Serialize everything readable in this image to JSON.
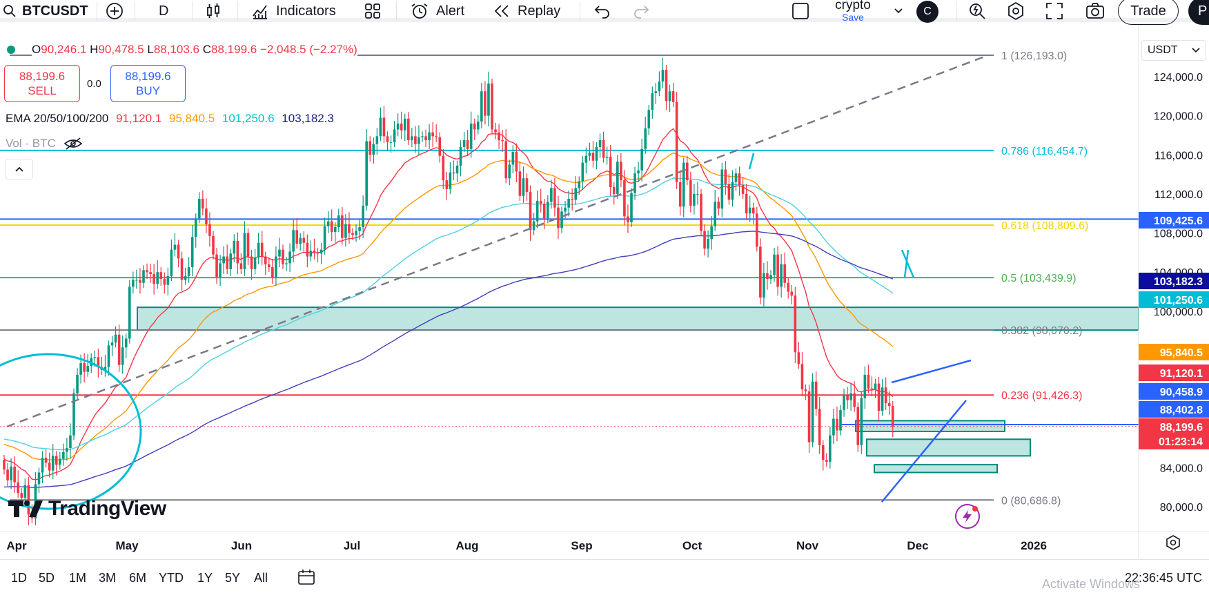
{
  "toolbar": {
    "symbol": "BTCUSDT",
    "interval": "D",
    "indicators_label": "Indicators",
    "alert_label": "Alert",
    "replay_label": "Replay",
    "layout_name": "crypto",
    "layout_status": "Save",
    "avatar_letter": "C",
    "trade_label": "Trade",
    "publish_letter": "P"
  },
  "legend": {
    "open_key": "O",
    "open": "90,246.1",
    "high_key": "H",
    "high": "90,478.5",
    "low_key": "L",
    "low": "88,103.6",
    "close_key": "C",
    "close": "88,199.6",
    "change": "−2,048.5 (−2.27%)",
    "sell_price": "88,199.6",
    "sell_label": "SELL",
    "spread": "0.0",
    "buy_price": "88,199.6",
    "buy_label": "BUY",
    "ema_label": "EMA 20/50/100/200",
    "ema20": "91,120.1",
    "ema50": "95,840.5",
    "ema100": "101,250.6",
    "ema200": "103,182.3",
    "vol_label": "Vol · BTC"
  },
  "currency": "USDT",
  "brand": "TradingView",
  "price_scale": [
    "124,000.0",
    "120,000.0",
    "116,000.0",
    "112,000.0",
    "108,000.0",
    "104,000.0",
    "100,000.0",
    "84,000.0",
    "80,000.0"
  ],
  "price_tags": [
    {
      "value": "109,425.6",
      "color": "#2962ff"
    },
    {
      "value": "103,182.3",
      "color": "#0c0c9e"
    },
    {
      "value": "101,250.6",
      "color": "#00bcd4"
    },
    {
      "value": "95,840.5",
      "color": "#ff9800"
    },
    {
      "value": "91,120.1",
      "color": "#f23645"
    },
    {
      "value": "90,458.9",
      "color": "#2962ff"
    },
    {
      "value": "88,402.8",
      "color": "#2962ff"
    },
    {
      "value": "88,199.6",
      "color": "#f23645"
    },
    {
      "value": "01:23:14",
      "color": "#f23645"
    }
  ],
  "fib_levels": [
    {
      "label": "1 (126,193.0)",
      "color": "#787b86"
    },
    {
      "label": "0.786 (116,454.7)",
      "color": "#00bcd4"
    },
    {
      "label": "0.618 (108,809.6)",
      "color": "#f2d600"
    },
    {
      "label": "0.5 (103,439.9)",
      "color": "#4caf50"
    },
    {
      "label": "0.382 (98,070.2)",
      "color": "#787b86"
    },
    {
      "label": "0.236 (91,426.3)",
      "color": "#f23645"
    },
    {
      "label": "0 (80,686.8)",
      "color": "#787b86"
    }
  ],
  "time_axis": [
    "Apr",
    "May",
    "Jun",
    "Jul",
    "Aug",
    "Sep",
    "Oct",
    "Nov",
    "Dec",
    "2026"
  ],
  "ranges": [
    "1D",
    "5D",
    "1M",
    "3M",
    "6M",
    "YTD",
    "1Y",
    "5Y",
    "All"
  ],
  "clock": "22:36:45 UTC",
  "watermark": "Activate Windows",
  "colors": {
    "up": "#089981",
    "down": "#f23645",
    "ema20": "#f23645",
    "ema50": "#ff9800",
    "ema100": "#00e5ff",
    "ema200": "#3f3fbf",
    "zone": "#00897b"
  },
  "chart_data": {
    "type": "candlestick",
    "title": "",
    "interval": "D",
    "xlabel": "",
    "ylabel": "",
    "ylim": [
      78500,
      126800
    ],
    "x_ticks": [
      "Apr",
      "May",
      "Jun",
      "Jul",
      "Aug",
      "Sep",
      "Oct",
      "Nov",
      "Dec",
      "2026"
    ],
    "x_tick_positions": [
      0,
      30,
      61,
      91,
      122,
      153,
      183,
      214,
      244,
      275
    ],
    "closes": [
      83800,
      82700,
      84100,
      82500,
      81400,
      80900,
      82200,
      79200,
      78800,
      82300,
      83500,
      85000,
      84500,
      83700,
      85200,
      84300,
      84900,
      85600,
      86000,
      87300,
      91600,
      93500,
      94700,
      93800,
      94400,
      95200,
      95300,
      94300,
      94000,
      94300,
      96500,
      96800,
      97600,
      94500,
      96300,
      97200,
      102500,
      103200,
      103200,
      102900,
      104200,
      104000,
      103800,
      102800,
      104000,
      103300,
      102700,
      103600,
      106300,
      106800,
      105400,
      103200,
      103600,
      104500,
      107600,
      109500,
      111500,
      110500,
      108900,
      107700,
      105800,
      103500,
      104900,
      105600,
      104300,
      105900,
      107200,
      104900,
      104300,
      108000,
      105600,
      104300,
      105500,
      107000,
      105600,
      104800,
      104500,
      103500,
      105600,
      106300,
      104800,
      104900,
      106100,
      108300,
      106900,
      107500,
      107000,
      105600,
      106200,
      106000,
      105900,
      106300,
      108700,
      109200,
      108100,
      108600,
      109800,
      107500,
      108900,
      108000,
      107800,
      108200,
      108600,
      110800,
      117400,
      116000,
      117100,
      117900,
      119800,
      117900,
      117300,
      117300,
      118600,
      119200,
      118500,
      119700,
      117500,
      117900,
      117100,
      117800,
      117900,
      117500,
      118300,
      117900,
      117800,
      115900,
      113400,
      112500,
      114200,
      114100,
      114900,
      116800,
      117500,
      116600,
      119200,
      118600,
      119400,
      122500,
      120000,
      123300,
      118600,
      118300,
      117500,
      117400,
      113600,
      115000,
      116300,
      114300,
      111800,
      113600,
      112200,
      108300,
      109200,
      111300,
      111000,
      109500,
      111200,
      112600,
      110600,
      108500,
      110200,
      110600,
      111500,
      111400,
      112600,
      113300,
      115200,
      115900,
      116200,
      115400,
      116800,
      117500,
      115700,
      115800,
      112700,
      112000,
      115300,
      113400,
      109700,
      109100,
      112100,
      114100,
      114400,
      116600,
      118700,
      120600,
      122300,
      122500,
      123500,
      124700,
      121500,
      122500,
      121400,
      113200,
      110700,
      115200,
      113400,
      110800,
      112000,
      112000,
      108200,
      106400,
      107400,
      108700,
      111200,
      110500,
      114500,
      113000,
      111400,
      113200,
      114100,
      112900,
      112000,
      110000,
      110600,
      110000,
      106600,
      101400,
      103900,
      103300,
      103700,
      105800,
      102500,
      104800,
      102900,
      102000,
      101600,
      95800,
      94600,
      92000,
      91800,
      86600,
      92800,
      90000,
      86300,
      84800,
      84600,
      87300,
      89000,
      87800,
      89900,
      91400,
      90900,
      91600,
      90200,
      86300,
      91100,
      93500,
      92100,
      92000,
      92600,
      89800,
      92200,
      90600,
      90300,
      88200
    ],
    "overlays": [
      {
        "type": "fib_retracement",
        "levels": [
          {
            "ratio": 1,
            "price": 126193.0
          },
          {
            "ratio": 0.786,
            "price": 116454.7
          },
          {
            "ratio": 0.618,
            "price": 108809.6
          },
          {
            "ratio": 0.5,
            "price": 103439.9
          },
          {
            "ratio": 0.382,
            "price": 98070.2
          },
          {
            "ratio": 0.236,
            "price": 91426.3
          },
          {
            "ratio": 0,
            "price": 80686.8
          }
        ]
      },
      {
        "type": "horizontal_line",
        "price": 109425.6
      },
      {
        "type": "horizontal_line",
        "price": 88402.8
      },
      {
        "type": "zone",
        "price_range": [
          98070,
          100400
        ]
      },
      {
        "type": "zone",
        "price_range": [
          87700,
          88800
        ]
      },
      {
        "type": "zone",
        "price_range": [
          85200,
          86900
        ]
      },
      {
        "type": "zone",
        "price_range": [
          83500,
          84300
        ]
      }
    ]
  }
}
